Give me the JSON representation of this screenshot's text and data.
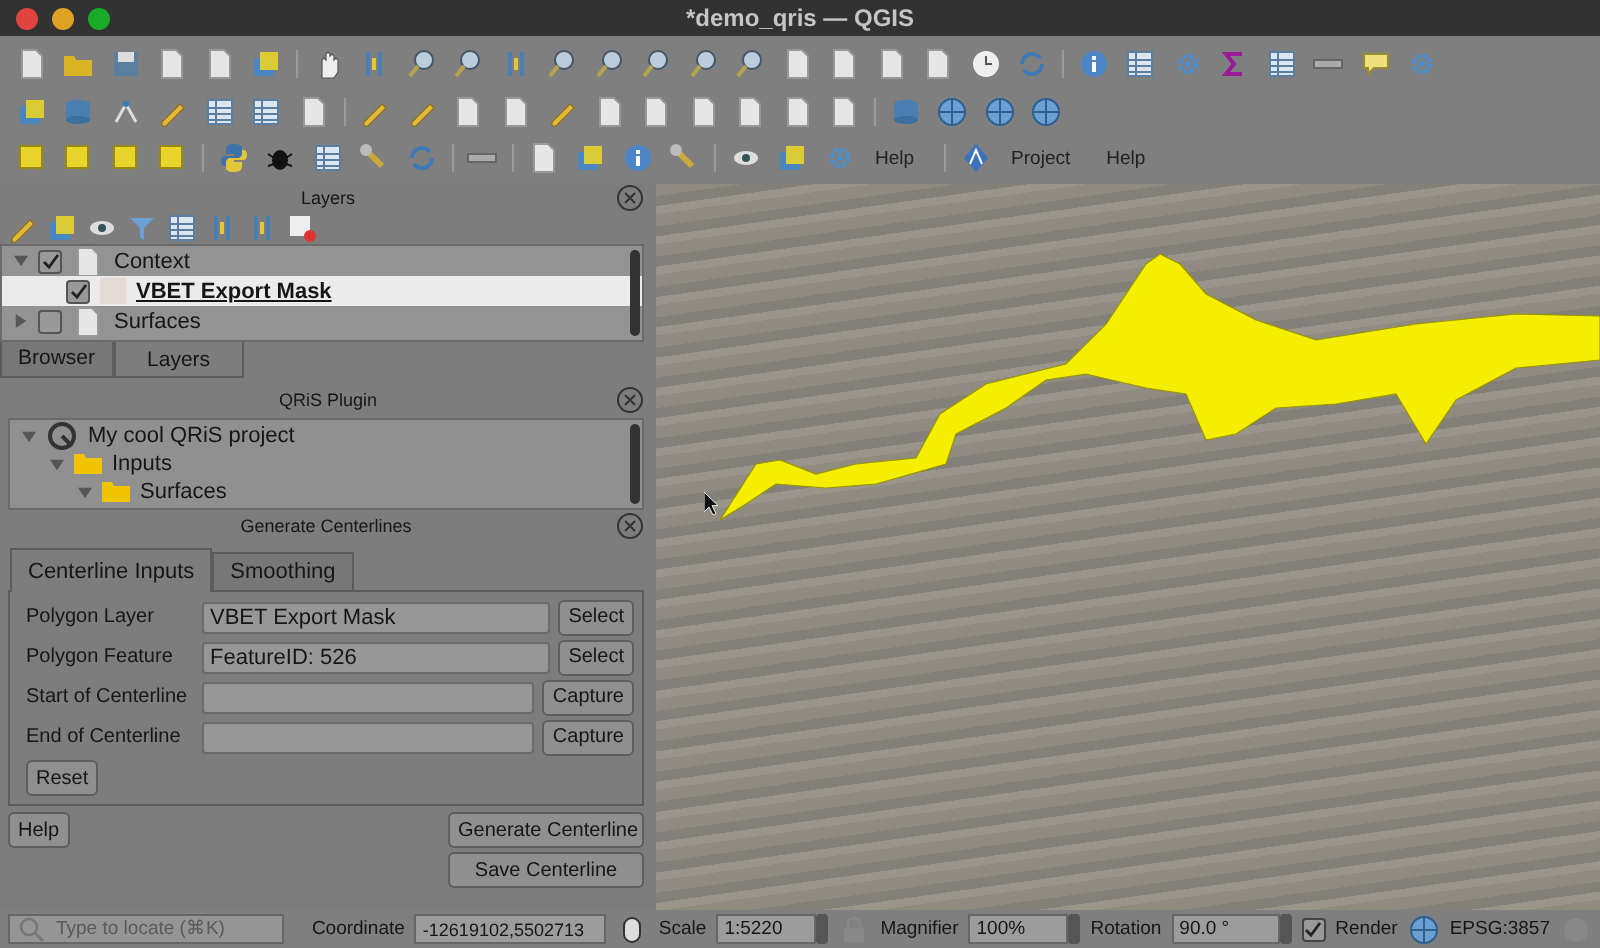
{
  "window": {
    "title": "*demo_qris — QGIS"
  },
  "toolbar": {
    "items": [
      {
        "label": "Help"
      },
      {
        "label": "Project"
      },
      {
        "label": "Help"
      }
    ]
  },
  "layers_panel": {
    "title": "Layers",
    "tree": [
      {
        "label": "Context",
        "checked": true,
        "expanded": true,
        "selected": false,
        "children": [
          {
            "label": "VBET Export Mask",
            "checked": true,
            "selected": true
          }
        ]
      },
      {
        "label": "Surfaces",
        "checked": false,
        "expanded": false,
        "selected": false
      }
    ],
    "tabs": [
      {
        "label": "Browser",
        "selected": false
      },
      {
        "label": "Layers",
        "selected": true
      }
    ]
  },
  "qris_panel": {
    "title": "QRiS Plugin",
    "tree": [
      {
        "label": "My cool QRiS project",
        "expanded": true,
        "children": [
          {
            "label": "Inputs",
            "expanded": true,
            "children": [
              {
                "label": "Surfaces",
                "expanded": true
              }
            ]
          }
        ]
      }
    ]
  },
  "centerlines_panel": {
    "title": "Generate Centerlines",
    "tabs": [
      {
        "label": "Centerline Inputs",
        "selected": true
      },
      {
        "label": "Smoothing",
        "selected": false
      }
    ],
    "fields": [
      {
        "label": "Polygon Layer",
        "value": "VBET Export Mask",
        "button": "Select"
      },
      {
        "label": "Polygon Feature",
        "value": "FeatureID: 526",
        "button": "Select"
      },
      {
        "label": "Start of Centerline",
        "button": "Capture"
      },
      {
        "label": "End of Centerline",
        "button": "Capture"
      }
    ],
    "reset": "Reset",
    "help": "Help",
    "generate": "Generate Centerline",
    "save": "Save Centerline"
  },
  "status_bar": {
    "locate_placeholder": "Type to locate (⌘K)",
    "coordinate_label": "Coordinate",
    "coordinate": "-12619102,5502713",
    "scale_label": "Scale",
    "scale": "1:5220",
    "magnifier_label": "Magnifier",
    "magnifier": "100%",
    "rotation_label": "Rotation",
    "rotation": "90.0 °",
    "render": {
      "label": "Render",
      "checked": true
    },
    "crs": "EPSG:3857"
  }
}
